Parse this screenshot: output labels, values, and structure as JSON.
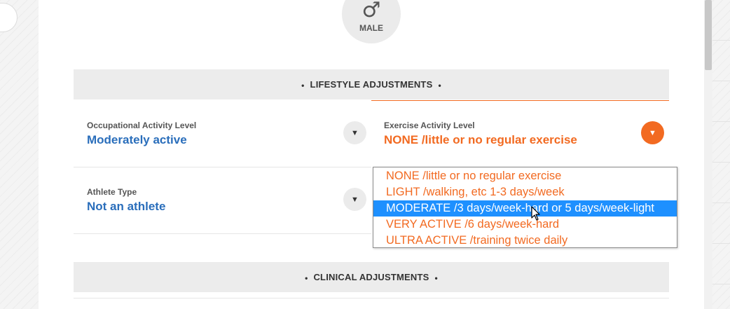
{
  "gender": {
    "symbol": "♂",
    "label": "MALE"
  },
  "lifestyle_header": {
    "title": "LIFESTYLE ADJUSTMENTS",
    "dot": "•"
  },
  "occupational": {
    "label": "Occupational Activity Level",
    "value": "Moderately active",
    "arrow": "▼"
  },
  "exercise": {
    "label": "Exercise Activity Level",
    "value": "NONE /little or no regular exercise",
    "arrow": "▼",
    "options": [
      "NONE /little or no regular exercise",
      "LIGHT /walking, etc 1-3 days/week",
      "MODERATE /3 days/week-hard or 5 days/week-light",
      "VERY ACTIVE /6 days/week-hard",
      "ULTRA ACTIVE /training twice daily"
    ],
    "highlighted_option": "MODERATE /3 days/week-hard or 5 days/week-light"
  },
  "athlete": {
    "label": "Athlete Type",
    "value": "Not an athlete",
    "arrow": "▼"
  },
  "clinical_header": {
    "title": "CLINICAL ADJUSTMENTS",
    "dot": "•"
  },
  "colors": {
    "accent": "#f26a21",
    "value_blue": "#2a6ebb",
    "highlight": "#1e90ff"
  }
}
